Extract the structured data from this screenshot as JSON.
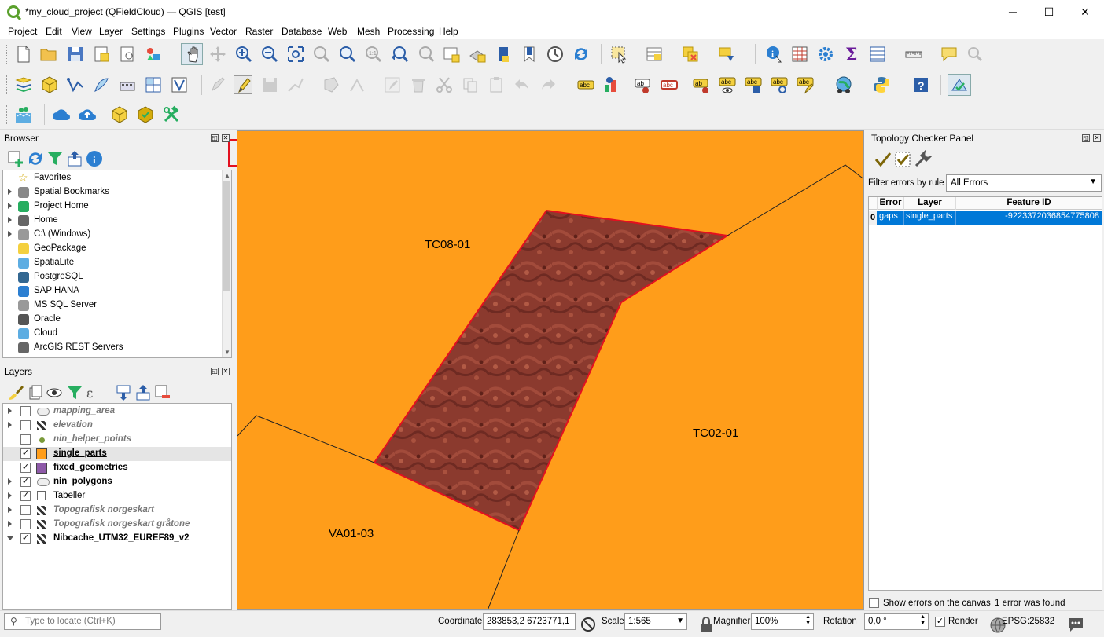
{
  "window": {
    "title": "*my_cloud_project (QFieldCloud) — QGIS [test]",
    "minimize": "─",
    "maximize": "☐",
    "close": "✕"
  },
  "menu": [
    "Project",
    "Edit",
    "View",
    "Layer",
    "Settings",
    "Plugins",
    "Vector",
    "Raster",
    "Database",
    "Web",
    "Mesh",
    "Processing",
    "Help"
  ],
  "browser": {
    "title": "Browser",
    "items": [
      {
        "label": "Favorites",
        "icon": "star-icon",
        "expand": false
      },
      {
        "label": "Spatial Bookmarks",
        "icon": "bookmark-icon",
        "expand": true
      },
      {
        "label": "Project Home",
        "icon": "project-home-icon",
        "expand": true
      },
      {
        "label": "Home",
        "icon": "home-icon",
        "expand": true
      },
      {
        "label": "C:\\ (Windows)",
        "icon": "drive-icon",
        "expand": true
      },
      {
        "label": "GeoPackage",
        "icon": "geopackage-icon",
        "expand": false
      },
      {
        "label": "SpatiaLite",
        "icon": "spatialite-icon",
        "expand": false
      },
      {
        "label": "PostgreSQL",
        "icon": "postgresql-icon",
        "expand": false
      },
      {
        "label": "SAP HANA",
        "icon": "sap-hana-icon",
        "expand": false
      },
      {
        "label": "MS SQL Server",
        "icon": "mssql-icon",
        "expand": false
      },
      {
        "label": "Oracle",
        "icon": "oracle-icon",
        "expand": false
      },
      {
        "label": "Cloud",
        "icon": "cloud-icon",
        "expand": false
      },
      {
        "label": "ArcGIS REST Servers",
        "icon": "arcgis-icon",
        "expand": false
      }
    ]
  },
  "layers": {
    "title": "Layers",
    "items": [
      {
        "label": "mapping_area",
        "checked": false,
        "style": "italic-gray",
        "icon": "polygon-layer-icon",
        "expand": true
      },
      {
        "label": "elevation",
        "checked": false,
        "style": "italic-gray",
        "icon": "raster-layer-icon",
        "expand": true
      },
      {
        "label": "nin_helper_points",
        "checked": false,
        "style": "italic-gray",
        "icon": "point-layer-icon",
        "expand": false
      },
      {
        "label": "single_parts",
        "checked": true,
        "style": "bold-underline",
        "icon": "orange-swatch",
        "expand": false
      },
      {
        "label": "fixed_geometries",
        "checked": true,
        "style": "bold",
        "icon": "purple-swatch",
        "expand": false
      },
      {
        "label": "nin_polygons",
        "checked": true,
        "style": "bold",
        "icon": "polygon-layer-icon",
        "expand": true
      },
      {
        "label": "Tabeller",
        "checked": true,
        "style": "normal",
        "icon": "group-icon",
        "expand": true
      },
      {
        "label": "Topografisk norgeskart",
        "checked": false,
        "style": "italic-gray",
        "icon": "raster-layer-icon",
        "expand": true
      },
      {
        "label": "Topografisk norgeskart gråtone",
        "checked": false,
        "style": "italic-gray",
        "icon": "raster-layer-icon",
        "expand": true
      },
      {
        "label": "Nibcache_UTM32_EUREF89_v2",
        "checked": true,
        "style": "bold",
        "icon": "raster-layer-icon",
        "expand": "open"
      }
    ]
  },
  "map": {
    "labels": [
      "TC08-01",
      "TC02-01",
      "VA01-03"
    ],
    "fill_color": "#ff9d1a"
  },
  "topology": {
    "title": "Topology Checker Panel",
    "filter_label": "Filter errors by rule",
    "filter_value": "All Errors",
    "columns": [
      "Error",
      "Layer",
      "Feature ID"
    ],
    "rows": [
      {
        "index": "0",
        "error": "gaps",
        "layer": "single_parts",
        "feature_id": "-9223372036854775808"
      }
    ],
    "show_errors_label": "Show errors on the canvas",
    "result": "1 error was found"
  },
  "statusbar": {
    "locate_placeholder": "Type to locate (Ctrl+K)",
    "coordinate_label": "Coordinate",
    "coordinate_value": "283853,2  6723771,1",
    "scale_label": "Scale",
    "scale_value": "1:565",
    "magnifier_label": "Magnifier",
    "magnifier_value": "100%",
    "rotation_label": "Rotation",
    "rotation_value": "0,0 °",
    "render_label": "Render",
    "crs": "EPSG:25832"
  }
}
